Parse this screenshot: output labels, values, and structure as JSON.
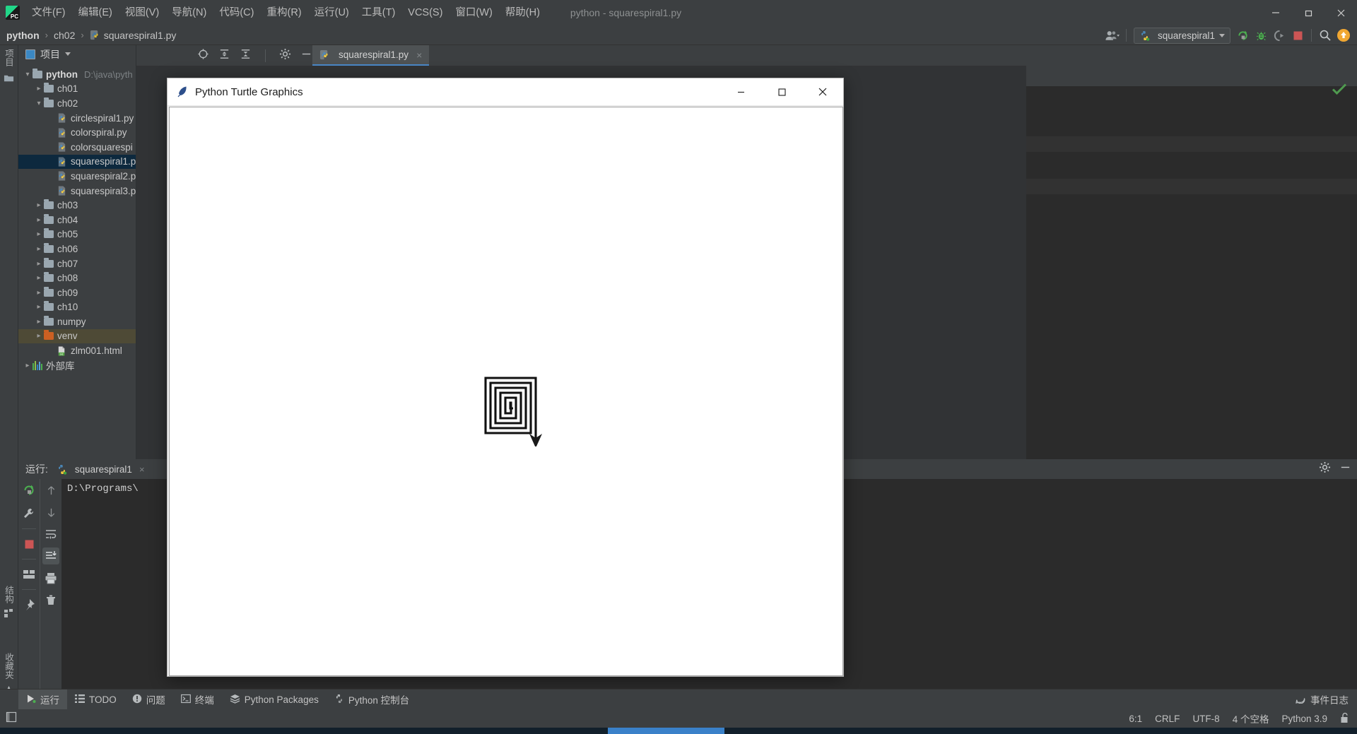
{
  "app": {
    "window_title": "python - squarespiral1.py",
    "logo_text": "PC"
  },
  "menu": {
    "items": [
      {
        "label": "文件(F)"
      },
      {
        "label": "编辑(E)"
      },
      {
        "label": "视图(V)"
      },
      {
        "label": "导航(N)"
      },
      {
        "label": "代码(C)"
      },
      {
        "label": "重构(R)"
      },
      {
        "label": "运行(U)"
      },
      {
        "label": "工具(T)"
      },
      {
        "label": "VCS(S)"
      },
      {
        "label": "窗口(W)"
      },
      {
        "label": "帮助(H)"
      }
    ]
  },
  "window_controls": {
    "minimize": "minimize-icon",
    "maximize": "restore-icon",
    "close": "close-icon"
  },
  "breadcrumb": {
    "items": [
      "python",
      "ch02",
      "squarespiral1.py"
    ],
    "separator": "›"
  },
  "toolbar": {
    "account_icon": "user-account-icon",
    "run_config_name": "squarespiral1",
    "buttons": [
      {
        "name": "run-button",
        "label": "Run"
      },
      {
        "name": "debug-button",
        "label": "Debug"
      },
      {
        "name": "coverage-button",
        "label": "Run with Coverage"
      },
      {
        "name": "stop-button",
        "label": "Stop"
      },
      {
        "name": "search-everywhere-button",
        "label": "Search"
      },
      {
        "name": "updates-button",
        "label": "Updates"
      }
    ]
  },
  "left_strip": {
    "project_label": "项目",
    "structure_label": "结构",
    "favorites_label": "收藏夹"
  },
  "project_panel": {
    "title": "项目",
    "tree": [
      {
        "label": "python",
        "detail": "D:\\java\\pyth",
        "type": "folder",
        "depth": 0,
        "arrow": "down",
        "bold": true
      },
      {
        "label": "ch01",
        "type": "folder",
        "depth": 1,
        "arrow": "right"
      },
      {
        "label": "ch02",
        "type": "folder",
        "depth": 1,
        "arrow": "down"
      },
      {
        "label": "circlespiral1.py",
        "type": "python",
        "depth": 2,
        "arrow": "none"
      },
      {
        "label": "colorspiral.py",
        "type": "python",
        "depth": 2,
        "arrow": "none"
      },
      {
        "label": "colorsquarespi",
        "type": "python",
        "depth": 2,
        "arrow": "none"
      },
      {
        "label": "squarespiral1.p",
        "type": "python",
        "depth": 2,
        "arrow": "none",
        "selected": true
      },
      {
        "label": "squarespiral2.p",
        "type": "python",
        "depth": 2,
        "arrow": "none"
      },
      {
        "label": "squarespiral3.p",
        "type": "python",
        "depth": 2,
        "arrow": "none"
      },
      {
        "label": "ch03",
        "type": "folder",
        "depth": 1,
        "arrow": "right"
      },
      {
        "label": "ch04",
        "type": "folder",
        "depth": 1,
        "arrow": "right"
      },
      {
        "label": "ch05",
        "type": "folder",
        "depth": 1,
        "arrow": "right"
      },
      {
        "label": "ch06",
        "type": "folder",
        "depth": 1,
        "arrow": "right"
      },
      {
        "label": "ch07",
        "type": "folder",
        "depth": 1,
        "arrow": "right"
      },
      {
        "label": "ch08",
        "type": "folder",
        "depth": 1,
        "arrow": "right"
      },
      {
        "label": "ch09",
        "type": "folder",
        "depth": 1,
        "arrow": "right"
      },
      {
        "label": "ch10",
        "type": "folder",
        "depth": 1,
        "arrow": "right"
      },
      {
        "label": "numpy",
        "type": "folder",
        "depth": 1,
        "arrow": "right"
      },
      {
        "label": "venv",
        "type": "folder-orange",
        "depth": 1,
        "arrow": "right",
        "highlighted": true
      },
      {
        "label": "zlm001.html",
        "type": "html",
        "depth": 2,
        "arrow": "none"
      },
      {
        "label": "外部库",
        "type": "library",
        "depth": 0,
        "arrow": "right"
      }
    ]
  },
  "editor": {
    "tab_label": "squarespiral1.py",
    "tab_close": "×",
    "tools": [
      "locate-icon",
      "expand-all-icon",
      "collapse-all-icon",
      "settings-icon",
      "hide-icon"
    ],
    "inspection_status": "ok-check-icon"
  },
  "run_panel": {
    "title": "运行:",
    "tab_label": "squarespiral1",
    "tab_close": "×",
    "console_text": "D:\\Programs\\",
    "left_buttons": [
      {
        "name": "rerun-button"
      },
      {
        "name": "settings-wrench-button"
      },
      {
        "name": "stop-button"
      },
      {
        "name": "layout-button"
      },
      {
        "name": "pin-button"
      }
    ],
    "right_buttons": [
      {
        "name": "up-arrow-button"
      },
      {
        "name": "down-arrow-button"
      },
      {
        "name": "soft-wrap-button"
      },
      {
        "name": "scroll-to-end-button"
      },
      {
        "name": "print-button"
      },
      {
        "name": "trash-button"
      }
    ],
    "header_right": [
      "settings-gear-icon",
      "hide-icon"
    ]
  },
  "turtle_window": {
    "title": "Python Turtle Graphics",
    "icon": "python-feather-icon",
    "minimize": "–",
    "maximize": "☐",
    "close": "✕",
    "drawing": "square-spiral"
  },
  "bottom_bar": {
    "items": [
      {
        "label": "运行",
        "icon": "run-icon",
        "active": true
      },
      {
        "label": "TODO",
        "icon": "todo-icon",
        "active": false
      },
      {
        "label": "问题",
        "icon": "problems-icon",
        "active": false
      },
      {
        "label": "终端",
        "icon": "terminal-icon",
        "active": false
      },
      {
        "label": "Python Packages",
        "icon": "packages-icon",
        "active": false
      },
      {
        "label": "Python 控制台",
        "icon": "python-console-icon",
        "active": false
      }
    ],
    "event_log": {
      "label": "事件日志",
      "icon": "event-log-icon"
    }
  },
  "status_bar": {
    "caret_position": "6:1",
    "line_separator": "CRLF",
    "encoding": "UTF-8",
    "indent": "4 个空格",
    "interpreter": "Python 3.9",
    "lock_icon": "unlocked-icon",
    "left_icon": "toggle-tool-window-icon"
  },
  "colors": {
    "accent_blue": "#4a88c7",
    "selection": "#0d293e",
    "highlight": "#4e4a36",
    "panel_bg": "#3c3f41",
    "editor_bg": "#2b2b2b",
    "green": "#4f9a4f",
    "red_stop": "#cc5555",
    "orange": "#e8a33d"
  }
}
